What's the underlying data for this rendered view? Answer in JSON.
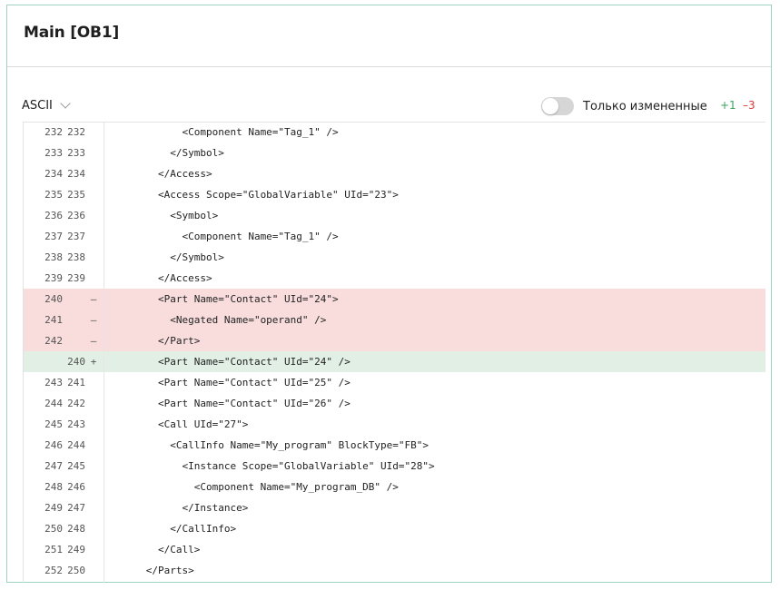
{
  "title": "Main [OB1]",
  "toolbar": {
    "encoding": "ASCII",
    "toggle_label": "Только измененные",
    "added": "+1",
    "removed": "–3"
  },
  "colors": {
    "deleted_bg": "#f9dddd",
    "added_bg": "#e1efe5",
    "added_text": "#3aa661",
    "removed_text": "#d93b3b"
  },
  "lines": [
    {
      "old": "232",
      "new": "232",
      "sign": "",
      "type": "ctx",
      "text": "            <Component Name=\"Tag_1\" />"
    },
    {
      "old": "233",
      "new": "233",
      "sign": "",
      "type": "ctx",
      "text": "          </Symbol>"
    },
    {
      "old": "234",
      "new": "234",
      "sign": "",
      "type": "ctx",
      "text": "        </Access>"
    },
    {
      "old": "235",
      "new": "235",
      "sign": "",
      "type": "ctx",
      "text": "        <Access Scope=\"GlobalVariable\" UId=\"23\">"
    },
    {
      "old": "236",
      "new": "236",
      "sign": "",
      "type": "ctx",
      "text": "          <Symbol>"
    },
    {
      "old": "237",
      "new": "237",
      "sign": "",
      "type": "ctx",
      "text": "            <Component Name=\"Tag_1\" />"
    },
    {
      "old": "238",
      "new": "238",
      "sign": "",
      "type": "ctx",
      "text": "          </Symbol>"
    },
    {
      "old": "239",
      "new": "239",
      "sign": "",
      "type": "ctx",
      "text": "        </Access>"
    },
    {
      "old": "240",
      "new": "",
      "sign": "–",
      "type": "del",
      "text": "        <Part Name=\"Contact\" UId=\"24\">"
    },
    {
      "old": "241",
      "new": "",
      "sign": "–",
      "type": "del",
      "text": "          <Negated Name=\"operand\" />"
    },
    {
      "old": "242",
      "new": "",
      "sign": "–",
      "type": "del",
      "text": "        </Part>"
    },
    {
      "old": "",
      "new": "240",
      "sign": "+",
      "type": "add",
      "text": "        <Part Name=\"Contact\" UId=\"24\" />"
    },
    {
      "old": "243",
      "new": "241",
      "sign": "",
      "type": "ctx",
      "text": "        <Part Name=\"Contact\" UId=\"25\" />"
    },
    {
      "old": "244",
      "new": "242",
      "sign": "",
      "type": "ctx",
      "text": "        <Part Name=\"Contact\" UId=\"26\" />"
    },
    {
      "old": "245",
      "new": "243",
      "sign": "",
      "type": "ctx",
      "text": "        <Call UId=\"27\">"
    },
    {
      "old": "246",
      "new": "244",
      "sign": "",
      "type": "ctx",
      "text": "          <CallInfo Name=\"My_program\" BlockType=\"FB\">"
    },
    {
      "old": "247",
      "new": "245",
      "sign": "",
      "type": "ctx",
      "text": "            <Instance Scope=\"GlobalVariable\" UId=\"28\">"
    },
    {
      "old": "248",
      "new": "246",
      "sign": "",
      "type": "ctx",
      "text": "              <Component Name=\"My_program_DB\" />"
    },
    {
      "old": "249",
      "new": "247",
      "sign": "",
      "type": "ctx",
      "text": "            </Instance>"
    },
    {
      "old": "250",
      "new": "248",
      "sign": "",
      "type": "ctx",
      "text": "          </CallInfo>"
    },
    {
      "old": "251",
      "new": "249",
      "sign": "",
      "type": "ctx",
      "text": "        </Call>"
    },
    {
      "old": "252",
      "new": "250",
      "sign": "",
      "type": "ctx",
      "text": "      </Parts>"
    }
  ]
}
